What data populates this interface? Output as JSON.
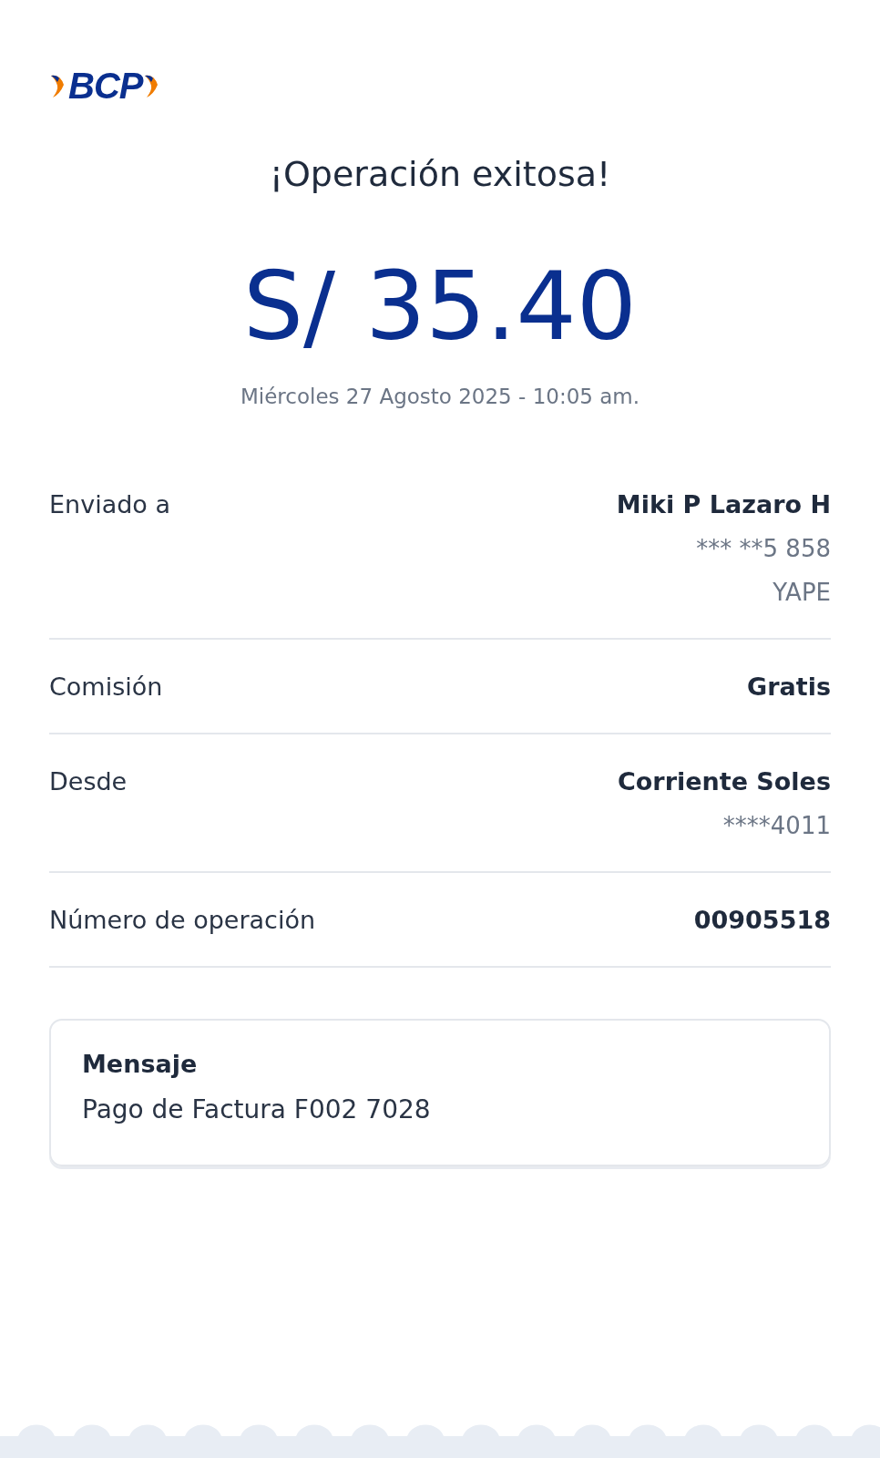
{
  "logo": {
    "text": "BCP"
  },
  "title": "¡Operación exitosa!",
  "amount": "S/ 35.40",
  "datetime": "Miércoles 27 Agosto 2025 - 10:05 am.",
  "details": [
    {
      "label": "Enviado a",
      "values": [
        {
          "text": "Miki P Lazaro H",
          "strong": true
        },
        {
          "text": "*** **5 858",
          "strong": false
        },
        {
          "text": "YAPE",
          "strong": false
        }
      ]
    },
    {
      "label": "Comisión",
      "values": [
        {
          "text": "Gratis",
          "strong": true
        }
      ]
    },
    {
      "label": "Desde",
      "values": [
        {
          "text": "Corriente Soles",
          "strong": true
        },
        {
          "text": "****4011",
          "strong": false
        }
      ]
    },
    {
      "label": "Número de operación",
      "values": [
        {
          "text": "00905518",
          "strong": true
        }
      ]
    }
  ],
  "message": {
    "heading": "Mensaje",
    "text": "Pago de Factura F002 7028"
  }
}
